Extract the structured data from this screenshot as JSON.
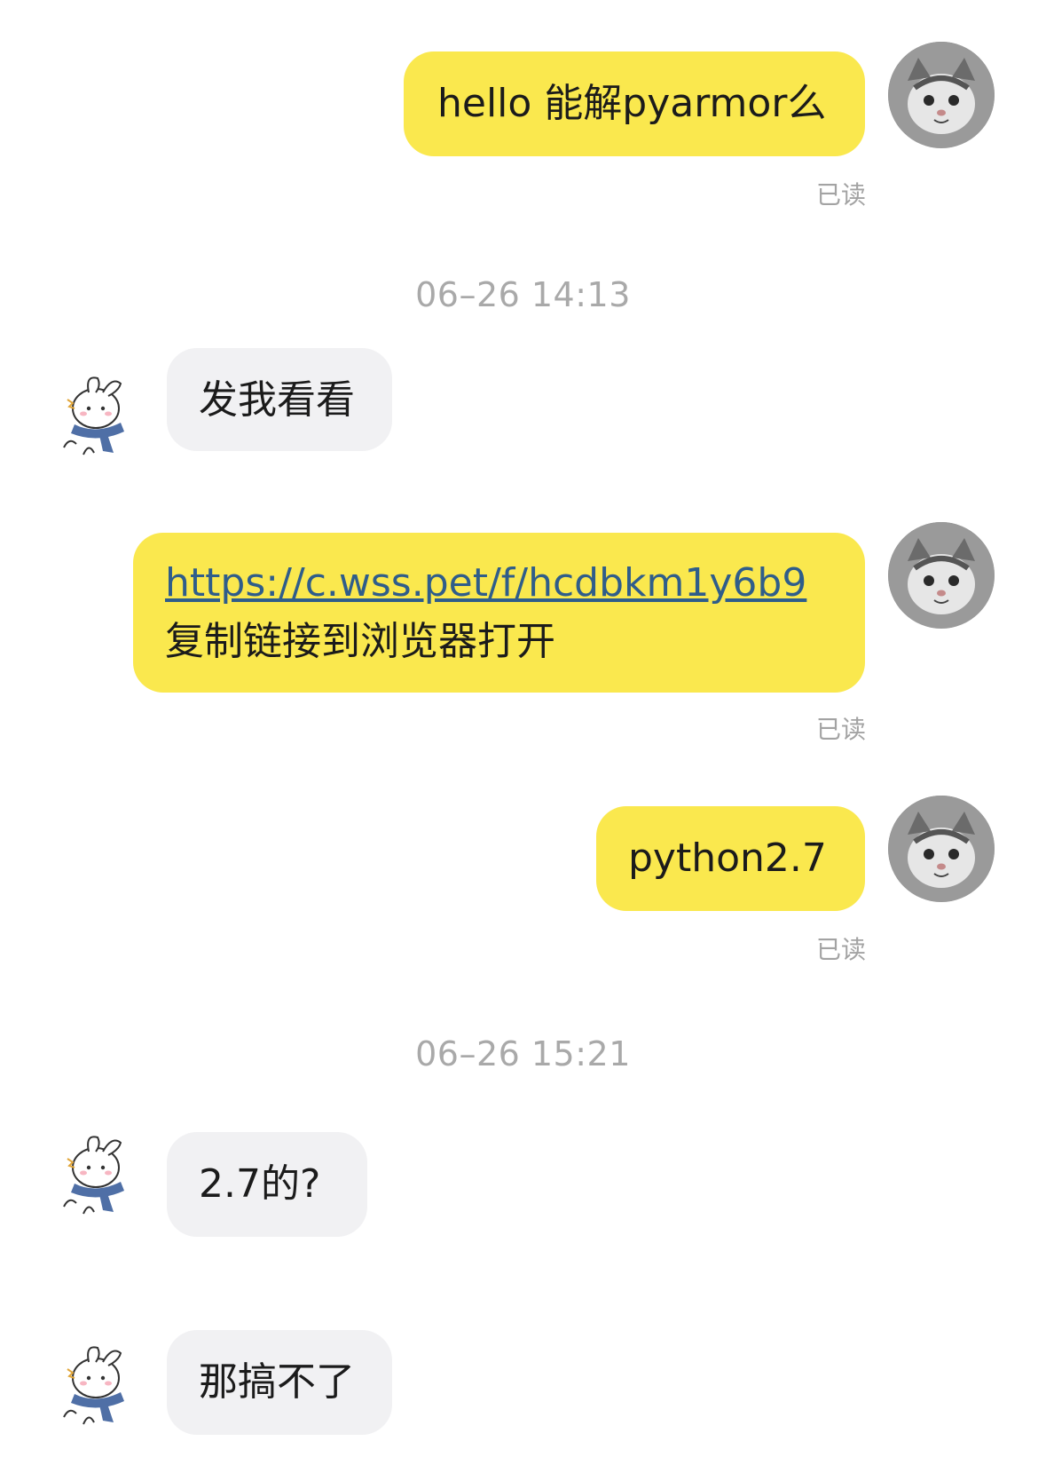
{
  "messages": [
    {
      "id": "m1",
      "side": "out",
      "text": "hello 能解pyarmor么",
      "status": "已读"
    },
    {
      "id": "t1",
      "type": "timestamp",
      "text": "06–26 14:13"
    },
    {
      "id": "m2",
      "side": "in",
      "text": "发我看看"
    },
    {
      "id": "m3",
      "side": "out",
      "link": "https://c.wss.pet/f/hcdbkm1y6b9",
      "text": "复制链接到浏览器打开",
      "status": "已读"
    },
    {
      "id": "m4",
      "side": "out",
      "text": "python2.7",
      "status": "已读"
    },
    {
      "id": "t2",
      "type": "timestamp",
      "text": "06–26 15:21"
    },
    {
      "id": "m5",
      "side": "in",
      "text": "2.7的?"
    },
    {
      "id": "m6",
      "side": "in",
      "text": "那搞不了"
    }
  ],
  "avatars": {
    "self": "cat-avatar",
    "peer": "bunny-scarf-avatar"
  },
  "colors": {
    "out_bubble": "#fae84e",
    "in_bubble": "#f1f1f3",
    "link": "#2f5d8a",
    "meta_text": "#a3a3a3"
  }
}
